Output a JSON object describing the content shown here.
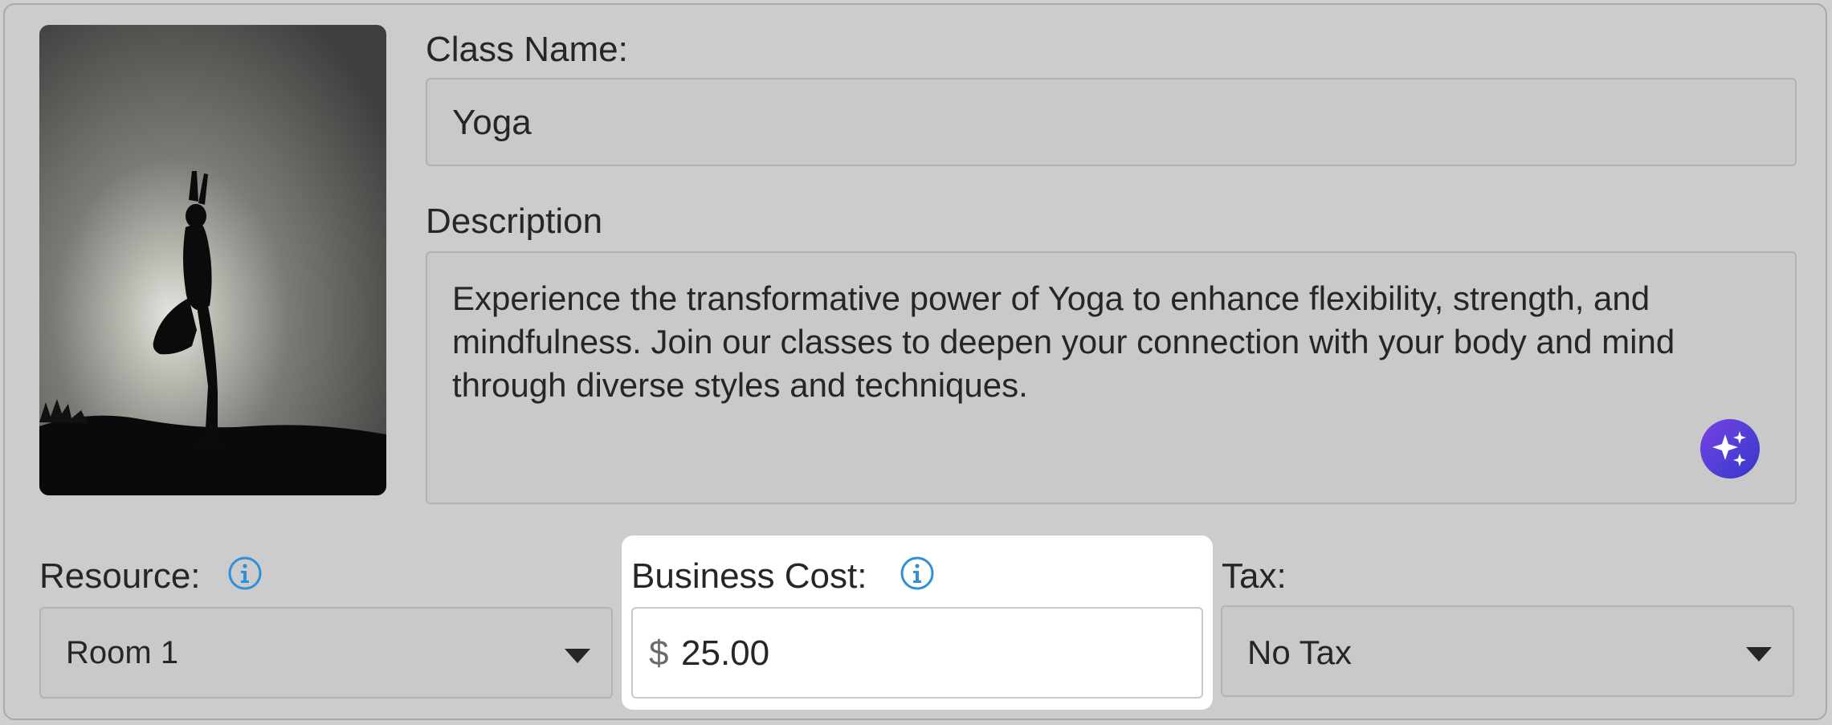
{
  "class_name": {
    "label": "Class Name:",
    "value": "Yoga"
  },
  "description": {
    "label": "Description",
    "value": "Experience the transformative power of Yoga to enhance flexibility, strength, and mindfulness. Join our classes to deepen your connection with your body and mind through diverse styles and techniques."
  },
  "resource": {
    "label": "Resource:",
    "selected": "Room 1"
  },
  "business_cost": {
    "label": "Business Cost:",
    "currency_symbol": "$",
    "value": "25.00"
  },
  "tax": {
    "label": "Tax:",
    "selected": "No Tax"
  },
  "icons": {
    "info": "info-icon",
    "ai": "sparkles-icon",
    "dropdown": "chevron-down-icon"
  },
  "colors": {
    "info_blue": "#2f8fd8",
    "ai_gradient_start": "#7b3fe4",
    "ai_gradient_end": "#3a35c8"
  }
}
